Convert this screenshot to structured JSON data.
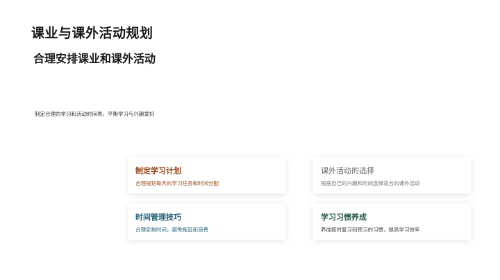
{
  "slide": {
    "title": "课业与课外活动规划",
    "subtitle": "合理安排课业和课外活动",
    "description": "制定合理的学习和活动时间表，平衡学习与兴趣爱好",
    "cards": [
      {
        "title": "制定学习计划",
        "text": "合理规划每天的学习任务和时间分配",
        "color": "#9a4a1d"
      },
      {
        "title": "课外活动的选择",
        "text": "根据自己的兴趣和时间选择适合的课外活动",
        "color": "#666666"
      },
      {
        "title": "时间管理技巧",
        "text": "合理安排时间，避免拖延和浪费",
        "color": "#215f78"
      },
      {
        "title": "学习习惯养成",
        "text": "养成按时复习和预习的习惯，提高学习效率",
        "color": "#2e5d4f"
      }
    ]
  }
}
